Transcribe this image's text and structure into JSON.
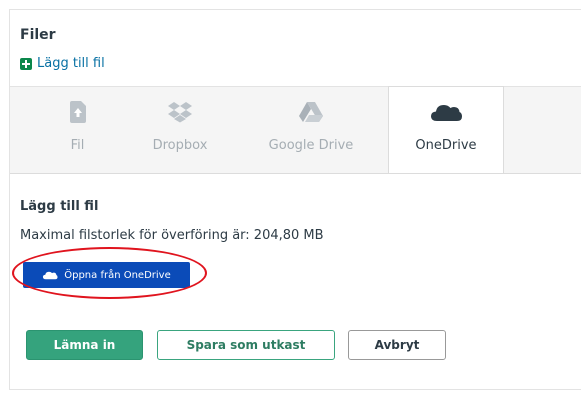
{
  "files": {
    "heading": "Filer",
    "add_file_link": "Lägg till fil"
  },
  "tabs": [
    {
      "label": "Fil",
      "icon": "upload-file-icon",
      "active": false
    },
    {
      "label": "Dropbox",
      "icon": "dropbox-icon",
      "active": false
    },
    {
      "label": "Google Drive",
      "icon": "google-drive-icon",
      "active": false
    },
    {
      "label": "OneDrive",
      "icon": "onedrive-cloud-icon",
      "active": true
    }
  ],
  "upload": {
    "title": "Lägg till fil",
    "max_size_text": "Maximal filstorlek för överföring är: 204,80 MB",
    "open_button": "Öppna från OneDrive"
  },
  "actions": {
    "submit": "Lämna in",
    "save_draft": "Spara som utkast",
    "cancel": "Avbryt"
  },
  "colors": {
    "link": "#0770a3",
    "onedrive_button": "#0b4bb8",
    "submit_button": "#35a37d",
    "highlight_oval": "#e0141e"
  }
}
